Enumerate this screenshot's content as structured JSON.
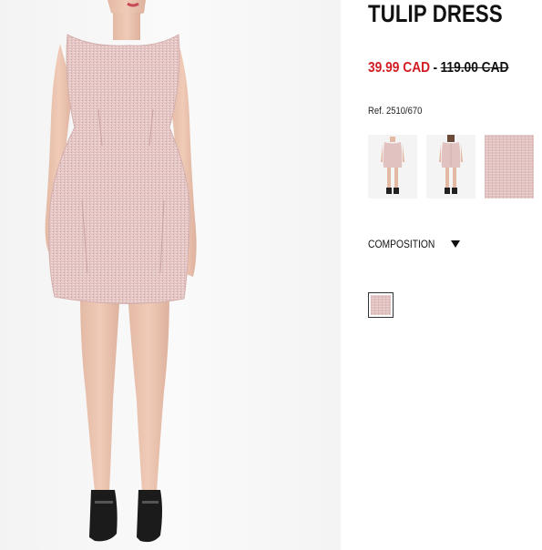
{
  "product": {
    "title": "TULIP DRESS",
    "sale_price": "39.99 CAD",
    "separator": "-",
    "original_price": "119.00 CAD",
    "reference": "Ref. 2510/670"
  },
  "gallery": {
    "main_image": "model-wearing-pink-tulip-dress-front",
    "thumbnails": [
      "dress-front-view",
      "dress-back-view",
      "fabric-detail"
    ]
  },
  "composition": {
    "label": "COMPOSITION",
    "icon": "triangle-down-icon"
  },
  "colors": {
    "sale": "#d11d23",
    "dress": "#e2c2c1",
    "swatch_selected": "pink"
  }
}
